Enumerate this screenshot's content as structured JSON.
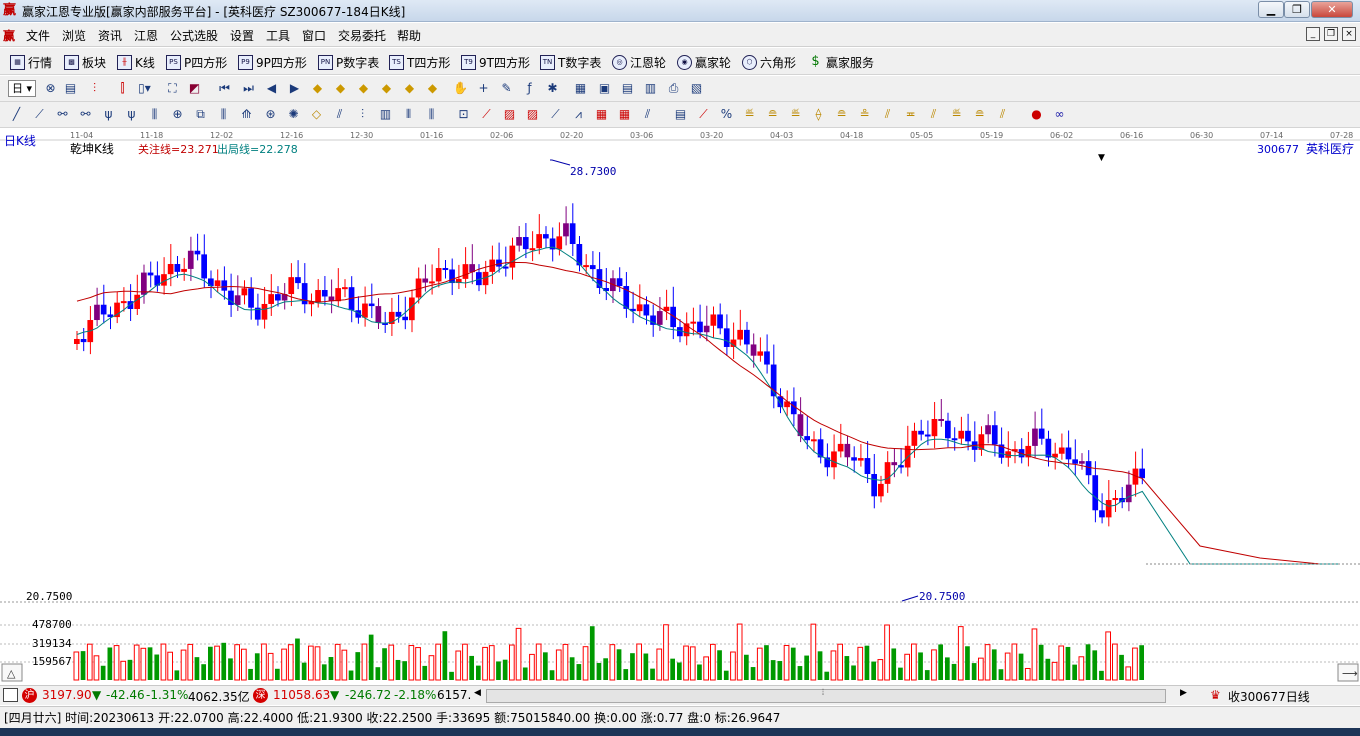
{
  "window": {
    "title": "赢家江恩专业版[赢家内部服务平台] - [英科医疗  SZ300677-184日K线]",
    "icon": "赢",
    "buttons": [
      "minimize-icon",
      "restore-icon",
      "close-icon"
    ]
  },
  "menu": {
    "icon": "赢",
    "items": [
      "文件",
      "浏览",
      "资讯",
      "江恩",
      "公式选股",
      "设置",
      "工具",
      "窗口",
      "交易委托",
      "帮助"
    ]
  },
  "toolbar1": {
    "items": [
      {
        "label": "行情",
        "icon": "grid-icon"
      },
      {
        "label": "板块",
        "icon": "blocks-icon"
      },
      {
        "label": "K线",
        "icon": "candles-icon"
      },
      {
        "label": "P四方形",
        "icon": "PS"
      },
      {
        "label": "9P四方形",
        "icon": "P9"
      },
      {
        "label": "P数字表",
        "icon": "PN"
      },
      {
        "label": "T四方形",
        "icon": "TS"
      },
      {
        "label": "9T四方形",
        "icon": "T9"
      },
      {
        "label": "T数字表",
        "icon": "TN"
      },
      {
        "label": "江恩轮",
        "icon": "wheel-icon"
      },
      {
        "label": "赢家轮",
        "icon": "wheel2-icon"
      },
      {
        "label": "六角形",
        "icon": "hexagon-icon"
      },
      {
        "label": "赢家服务",
        "icon": "dollar-icon"
      }
    ]
  },
  "toolbar2": {
    "period": "日",
    "icons": [
      "cross-icon",
      "table-icon",
      "kline-icon",
      "bar-icon",
      "search-icon",
      "zoom-icon",
      "play-first-icon",
      "play-end-icon",
      "left-icon",
      "right-icon",
      "diamond1-icon",
      "diamond2-icon",
      "diamond3-icon",
      "diamond4-icon",
      "diamond5-icon",
      "diamond6-icon",
      "hand-icon",
      "plus-icon",
      "draw-icon",
      "fx-icon",
      "formula-icon",
      "calendar-icon",
      "calc-icon",
      "note-icon",
      "doc-icon",
      "print-icon"
    ]
  },
  "toolbar3": {
    "icons": [
      "line-icon",
      "fan-icon",
      "fork-icon",
      "grid1-icon",
      "grid2-icon",
      "grid3-icon",
      "grid4-icon",
      "arc-icon",
      "circle-icon",
      "spiral-icon",
      "ruler-icon",
      "wave-icon",
      "star-icon",
      "tri-icon",
      "channel-icon",
      "pitch-icon",
      "box-icon",
      "text-icon",
      "rect-icon",
      "erase-icon",
      "angle1-icon",
      "angle2-icon",
      "angle3-icon",
      "angle4-icon",
      "time-icon",
      "price-icon",
      "percent-icon",
      "gann1-icon",
      "gann2-icon",
      "gann3-icon",
      "gann4-icon",
      "gann5-icon",
      "gann6-icon",
      "gann7-icon",
      "gann8-icon",
      "gann9-icon",
      "gann10-icon",
      "gann11-icon",
      "gann12-icon",
      "color-icon",
      "loop-icon"
    ]
  },
  "chart": {
    "period_label": "日K线",
    "indicator_name": "乾坤K线",
    "focus_line": "关注线=23.271",
    "exit_line": "出局线=22.278",
    "stock_code": "300677",
    "stock_name": "英科医疗",
    "date_axis": [
      "11-04",
      "11-18",
      "12-02",
      "12-16",
      "12-30",
      "01-16",
      "02-06",
      "02-20",
      "03-06",
      "03-20",
      "04-03",
      "04-18",
      "05-05",
      "05-19",
      "06-02",
      "06-16",
      "06-30",
      "07-14",
      "07-28"
    ],
    "high_label": "28.7300",
    "low_label": "20.7500",
    "price_axis_label": "20.7500",
    "volume_axis": [
      "478700",
      "319134",
      "159567"
    ],
    "colors": {
      "up": "#ff0000",
      "down": "#0000ff",
      "neutral": "#800080",
      "focus": "#c00000",
      "exit": "#008080",
      "volume_up": "#ff0000",
      "volume_down": "#009900"
    }
  },
  "chart_data": {
    "type": "candlestick",
    "title": "乾坤K线",
    "symbol": "300677 英科医疗",
    "x": [
      "11-04",
      "11-18",
      "12-02",
      "12-16",
      "12-30",
      "01-16",
      "02-06",
      "02-20",
      "03-06",
      "03-20",
      "04-03",
      "04-18",
      "05-05",
      "05-19",
      "06-02",
      "06-16",
      "06-30",
      "07-14",
      "07-28"
    ],
    "price_high": 28.73,
    "price_low": 20.75,
    "focus_line": 23.271,
    "exit_line": 22.278,
    "volume_ticks": [
      478700,
      319134,
      159567
    ]
  },
  "status1": {
    "sh_icon": "沪",
    "sh_index": "3197.90",
    "sh_change": "-42.46",
    "sh_pct": "-1.31%",
    "sh_amount": "4062.35亿",
    "sz_icon": "深",
    "sz_index": "11058.63",
    "sz_change": "-246.72",
    "sz_pct": "-2.18%",
    "sz_amount": "6157.",
    "right_text": "收300677日线"
  },
  "status2": {
    "text": "[四月廿六] 时间:20230613 开:22.0700 高:22.4000 低:21.9300 收:22.2500 手:33695 额:75015840.00 换:0.00 涨:0.77 盘:0 标:26.9647"
  }
}
